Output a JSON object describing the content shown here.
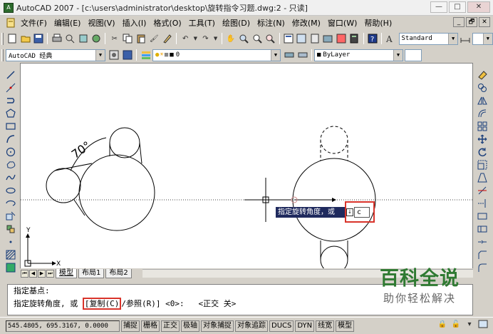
{
  "window": {
    "title": "AutoCAD 2007 - [c:\\users\\administrator\\desktop\\旋转指令习题.dwg:2 - 只读]",
    "controls": {
      "minimize": "—",
      "maximize": "□",
      "close": "✕"
    }
  },
  "menu": [
    "文件(F)",
    "编辑(E)",
    "视图(V)",
    "插入(I)",
    "格式(O)",
    "工具(T)",
    "绘图(D)",
    "标注(N)",
    "修改(M)",
    "窗口(W)",
    "帮助(H)"
  ],
  "mdi_controls": [
    "_",
    "🗗",
    "✕"
  ],
  "toolbar": {
    "text_style": "Standard",
    "workspace": "AutoCAD 经典",
    "layer": "0",
    "color": "ByLayer"
  },
  "drawing": {
    "angle_dim": "70°",
    "ucs_x": "X",
    "ucs_y": "Y"
  },
  "dynamic_input": {
    "prompt": "指定旋转角度，或",
    "icon": "↓",
    "value": "c"
  },
  "layout_tabs": [
    "模型",
    "布局1",
    "布局2"
  ],
  "command_lines": [
    "指定基点:",
    "指定旋转角度, 或 "
  ],
  "command_option": "[复制(C)",
  "command_rest": "/参照(R)] <0>:   <正交 关>",
  "status": {
    "coords": "545.4805, 695.3167, 0.0000",
    "buttons": [
      "捕捉",
      "栅格",
      "正交",
      "极轴",
      "对象捕捉",
      "对象追踪",
      "DUCS",
      "DYN",
      "线宽",
      "模型"
    ]
  },
  "watermark": {
    "title": "百科全说",
    "subtitle": "助你轻松解决"
  }
}
